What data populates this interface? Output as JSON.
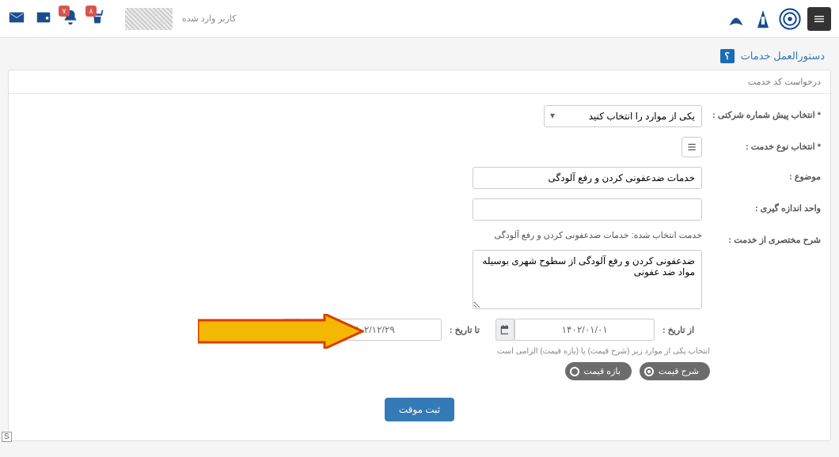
{
  "header": {
    "user_label": "کاربر وارد شده",
    "badge_notif": "۷",
    "badge_cart": "۸"
  },
  "titlebar": {
    "title": "دستورالعمل خدمات",
    "help": "؟"
  },
  "panel": {
    "header": "درخواست کد خدمت",
    "labels": {
      "prefix": "* انتخاب پیش شماره شرکتی :",
      "service_type": "* انتخاب نوع خدمت :",
      "subject": "موضوع :",
      "unit": "واحد اندازه گیری :",
      "summary": "شرح مختصری از خدمت :",
      "from_date": "از تاریخ :",
      "to_date": "تا تاریخ :"
    },
    "select_placeholder": "یکی از موارد را انتخاب کنید",
    "subject_value": "خدمات ضدعفونی کردن و رفع آلودگی",
    "selected_text": "خدمت انتخاب شده: خدمات ضدعفونی کردن و رفع آلودگی",
    "summary_value": "ضدعفونی کردن و رفع آلودگی از سطوح شهری بوسیله مواد ضد عفونی",
    "from_date_value": "۱۴۰۲/۰۱/۰۱",
    "to_date_value": "۱۴۰۲/۱۲/۲۹",
    "note": "انتخاب یکی از موارد زیر (شرح قیمت) یا (بازه قیمت) الزامی است",
    "pill_desc": "شرح قیمت",
    "pill_range": "بازه قیمت",
    "submit": "ثبت موقت"
  },
  "status_corner": "S"
}
